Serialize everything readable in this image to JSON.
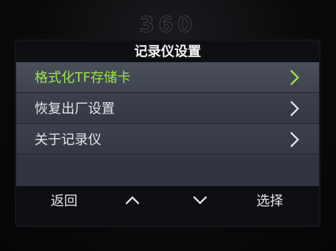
{
  "device": {
    "brand_logo": "360"
  },
  "screen": {
    "title": "记录仪设置",
    "menu": [
      {
        "label": "格式化TF存储卡",
        "selected": true
      },
      {
        "label": "恢复出厂设置",
        "selected": false
      },
      {
        "label": "关于记录仪",
        "selected": false
      }
    ],
    "softkeys": {
      "back_label": "返回",
      "up_icon": "chevron-up-icon",
      "down_icon": "chevron-down-icon",
      "select_label": "选择"
    }
  },
  "colors": {
    "selected_text": "#9be54a",
    "normal_text": "#e6e6e6",
    "bar_background": "#0e0f13",
    "menu_background": "#3b404c"
  }
}
